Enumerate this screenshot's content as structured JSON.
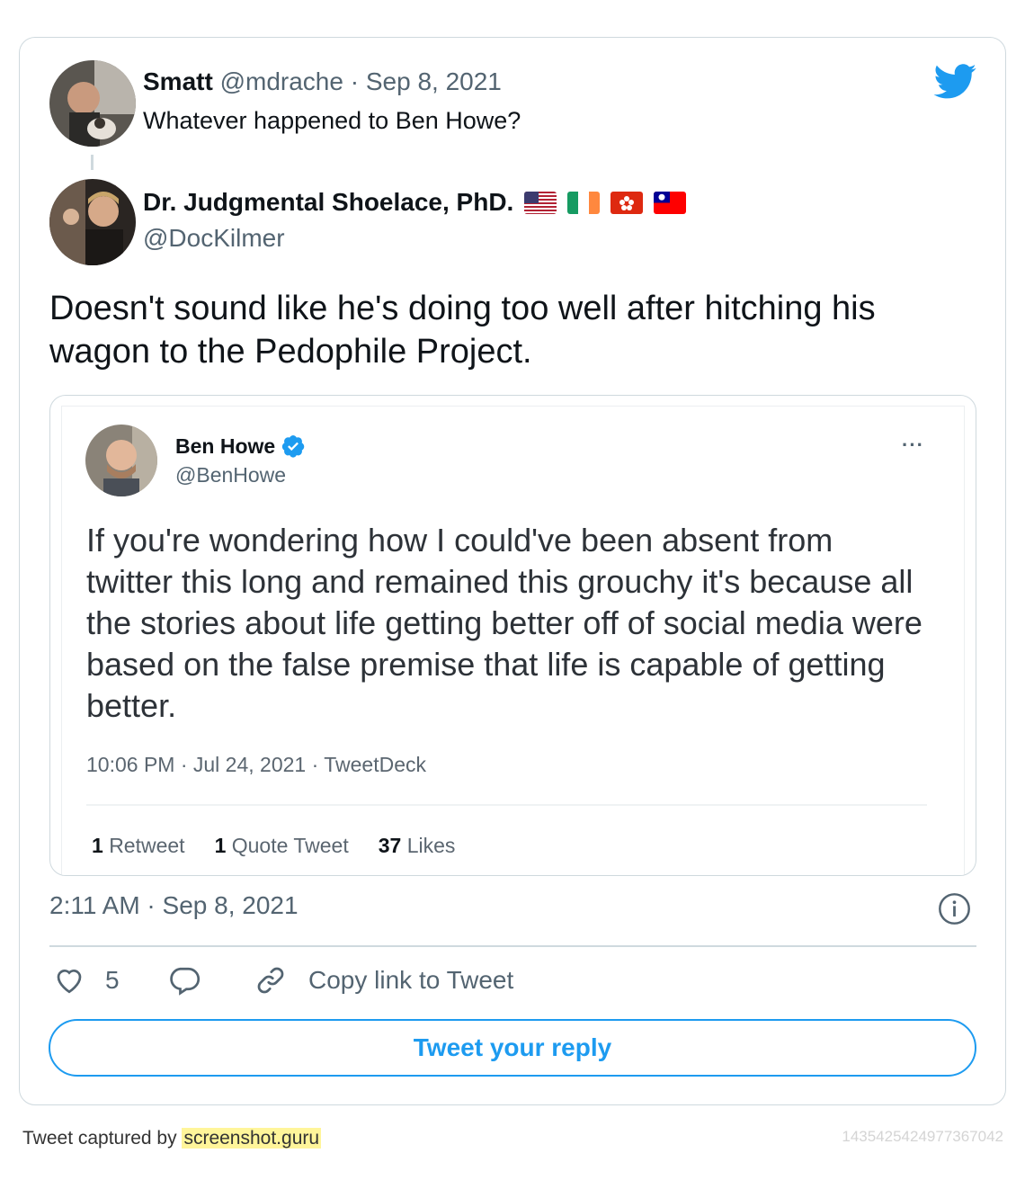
{
  "parent_tweet": {
    "display_name": "Smatt",
    "handle": "@mdrache",
    "date": "· Sep 8, 2021",
    "text": "Whatever happened to Ben Howe?"
  },
  "main_tweet": {
    "display_name": "Dr. Judgmental Shoelace, PhD.",
    "flags": [
      "us-flag",
      "ireland-flag",
      "hong-kong-flag",
      "taiwan-flag"
    ],
    "handle": "@DocKilmer",
    "text": "Doesn't sound like he's doing too well after hitching his wagon to the Pedophile Project.",
    "timestamp": "2:11 AM · Sep 8, 2021"
  },
  "quoted_tweet": {
    "display_name": "Ben Howe",
    "handle": "@BenHowe",
    "more_label": "···",
    "text": "If you're wondering how I could've been absent from twitter this long and remained this grouchy it's because all the stories about life getting better off of social media were based on the false premise that life is capable of getting better.",
    "meta": "10:06 PM · Jul 24, 2021 · TweetDeck",
    "stats": [
      {
        "count": "1",
        "label": "Retweet"
      },
      {
        "count": "1",
        "label": "Quote Tweet"
      },
      {
        "count": "37",
        "label": "Likes"
      }
    ]
  },
  "actions": {
    "like_count": "5",
    "copy_link_label": "Copy link to Tweet"
  },
  "reply_button_label": "Tweet your reply",
  "footer": {
    "captured_prefix": "Tweet captured by",
    "captured_site": "screenshot.guru",
    "tweet_id": "1435425424977367042"
  },
  "colors": {
    "twitter_blue": "#1d9bf0",
    "muted_text": "#536471",
    "border": "#cfd9de",
    "highlight": "#fff59a"
  }
}
